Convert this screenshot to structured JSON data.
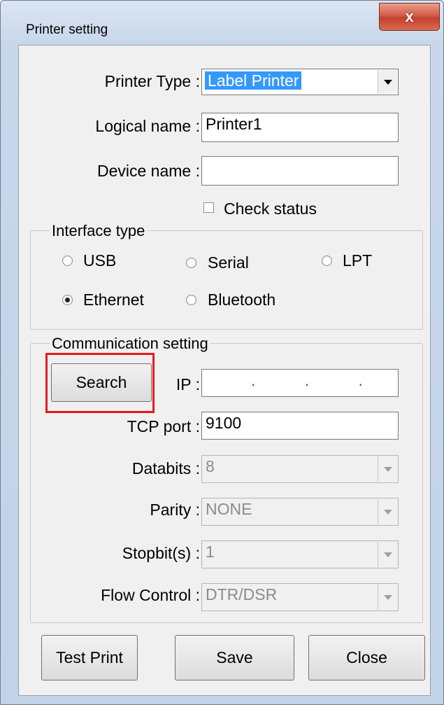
{
  "window": {
    "title": "Printer setting",
    "close_glyph": "x"
  },
  "printer_type": {
    "label": "Printer Type :",
    "value": "Label Printer"
  },
  "logical_name": {
    "label": "Logical name :",
    "value": "Printer1"
  },
  "device_name": {
    "label": "Device name :",
    "value": ""
  },
  "check_status": {
    "label": "Check status",
    "checked": false
  },
  "interface": {
    "legend": "Interface type",
    "options": [
      {
        "label": "USB",
        "selected": false
      },
      {
        "label": "Serial",
        "selected": false
      },
      {
        "label": "LPT",
        "selected": false
      },
      {
        "label": "Ethernet",
        "selected": true
      },
      {
        "label": "Bluetooth",
        "selected": false
      }
    ]
  },
  "communication": {
    "legend": "Communication setting",
    "search_label": "Search",
    "ip_label": "IP :",
    "ip_value": ". . .",
    "tcp_label": "TCP port :",
    "tcp_value": "9100",
    "databits_label": "Databits :",
    "databits_value": "8",
    "parity_label": "Parity :",
    "parity_value": "NONE",
    "stopbits_label": "Stopbit(s) :",
    "stopbits_value": "1",
    "flow_label": "Flow Control :",
    "flow_value": "DTR/DSR"
  },
  "buttons": {
    "test_print": "Test Print",
    "save": "Save",
    "close": "Close"
  },
  "colors": {
    "highlight": "#e8191c",
    "selection": "#3399ff"
  }
}
